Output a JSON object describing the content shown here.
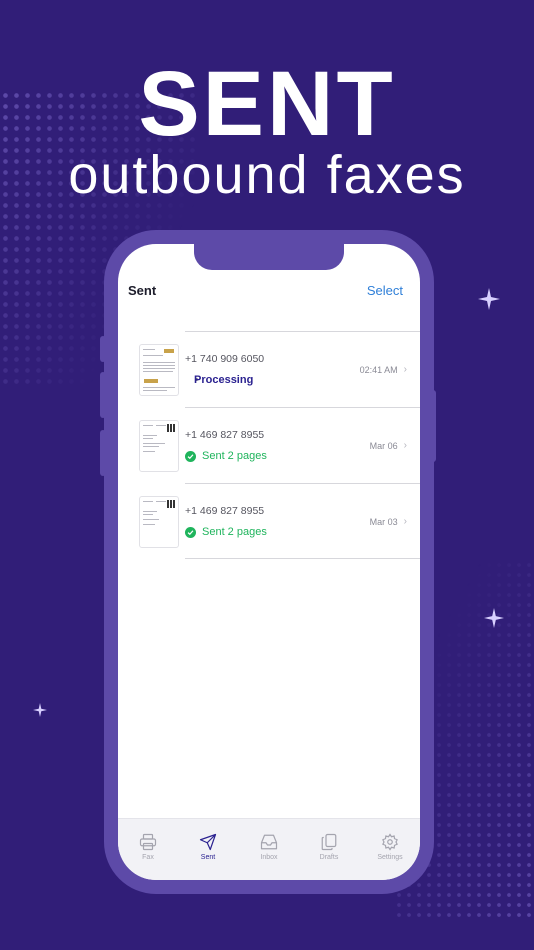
{
  "hero": {
    "headline": "SENT",
    "subline": "outbound faxes"
  },
  "nav": {
    "title": "Sent",
    "select_label": "Select"
  },
  "faxes": [
    {
      "number": "+1 740 909 6050",
      "status": "Processing",
      "date": "02:41 AM"
    },
    {
      "number": "+1 469 827 8955",
      "status": "Sent 2 pages",
      "date": "Mar 06"
    },
    {
      "number": "+1 469 827 8955",
      "status": "Sent 2 pages",
      "date": "Mar 03"
    }
  ],
  "tabs": [
    {
      "label": "Fax",
      "icon": "printer-icon"
    },
    {
      "label": "Sent",
      "icon": "paper-plane-icon"
    },
    {
      "label": "Inbox",
      "icon": "inbox-tray-icon"
    },
    {
      "label": "Drafts",
      "icon": "copy-document-icon"
    },
    {
      "label": "Settings",
      "icon": "gear-icon"
    }
  ],
  "colors": {
    "background": "#311e78",
    "phone_frame": "#5d4aa8",
    "accent_select": "#2f7fd8",
    "sent_green": "#1fb45c",
    "processing_purple": "#2b2290"
  }
}
